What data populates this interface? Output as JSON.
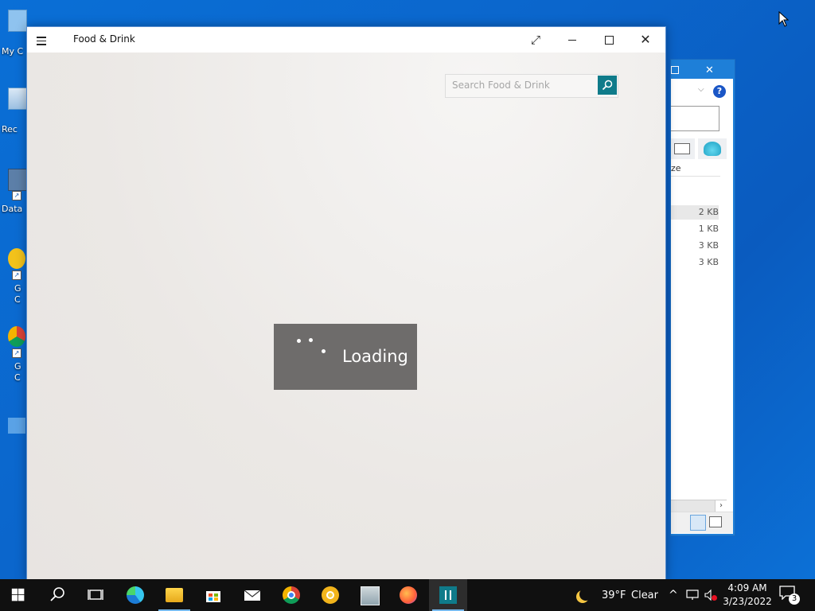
{
  "desktop": {
    "icons": [
      {
        "label": "My C"
      },
      {
        "label": "Rec"
      },
      {
        "label": "Data"
      },
      {
        "label": "G"
      },
      {
        "label": "C"
      },
      {
        "label": "G"
      },
      {
        "label": "C"
      }
    ]
  },
  "background_window": {
    "close_glyph": "✕",
    "help_glyph": "?",
    "column_header": "ze",
    "rows": [
      "2 KB",
      "1 KB",
      "3 KB",
      "3 KB"
    ],
    "scroll_arrow": "›"
  },
  "app": {
    "title": "Food & Drink",
    "search_placeholder": "Search Food & Drink",
    "loading_text": "Loading",
    "buttons": {
      "fullscreen_glyph": "⤢",
      "close_glyph": "✕"
    }
  },
  "taskbar": {
    "items": [
      {
        "name": "start",
        "icon": "windows-logo-icon"
      },
      {
        "name": "search",
        "icon": "search-icon"
      },
      {
        "name": "task-view",
        "icon": "task-view-icon"
      },
      {
        "name": "edge",
        "icon": "edge-icon"
      },
      {
        "name": "file-explorer",
        "icon": "folder-icon"
      },
      {
        "name": "store",
        "icon": "store-icon"
      },
      {
        "name": "mail",
        "icon": "mail-icon"
      },
      {
        "name": "chrome",
        "icon": "chrome-icon"
      },
      {
        "name": "chrome-canary",
        "icon": "chrome-canary-icon"
      },
      {
        "name": "app-generic",
        "icon": "picture-app-icon"
      },
      {
        "name": "firefox",
        "icon": "firefox-icon"
      },
      {
        "name": "food-drink",
        "icon": "fork-knife-icon"
      }
    ],
    "weather": {
      "temp": "39°F",
      "condition": "Clear"
    },
    "tray_chevron": "^",
    "clock": {
      "time": "4:09 AM",
      "date": "3/23/2022"
    },
    "notification_count": "3"
  },
  "colors": {
    "desktop": "#0b66cc",
    "taskbar": "#101010",
    "search_button": "#0f7b8a",
    "loading_box": "#6e6c6b",
    "taskbar_active_indicator": "#76b9ed"
  }
}
